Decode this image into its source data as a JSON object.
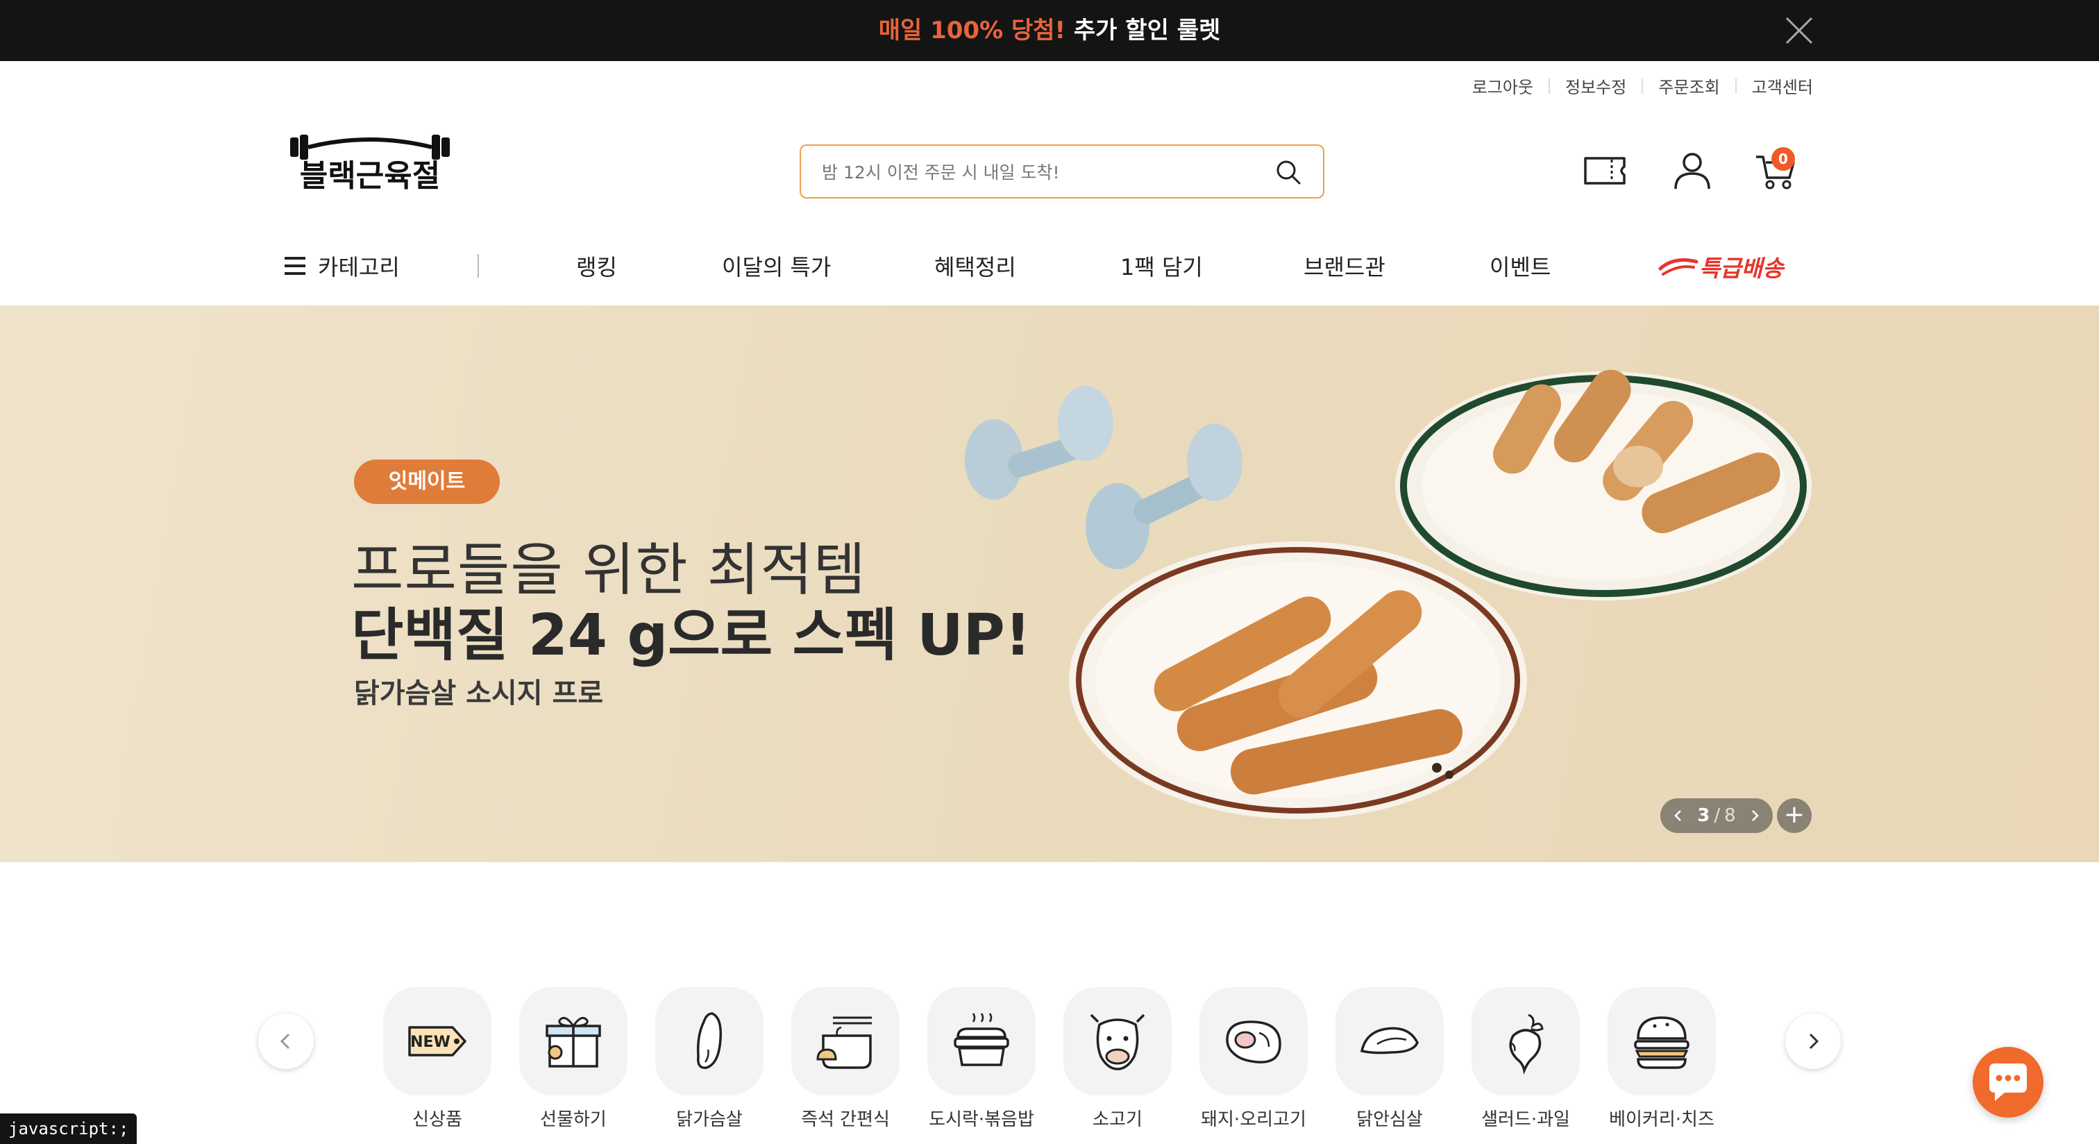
{
  "promo": {
    "text_prefix": "매일 100% 당첨!",
    "text_suffix": "추가 할인 룰렛"
  },
  "util_links": [
    "로그아웃",
    "정보수정",
    "주문조회",
    "고객센터"
  ],
  "logo_text": "블랙근육절",
  "search": {
    "placeholder": "밤 12시 이전 주문 시 내일 도착!"
  },
  "cart": {
    "count": "0"
  },
  "nav": {
    "category_label": "카테고리",
    "items": [
      "랭킹",
      "이달의 특가",
      "혜택정리",
      "1팩 담기",
      "브랜드관",
      "이벤트"
    ],
    "express_label": "특급배송"
  },
  "banner": {
    "tag": "잇메이트",
    "headline1": "프로들을 위한 최적템",
    "headline2": "단백질 24 g으로 스펙 UP!",
    "subtitle": "닭가슴살 소시지 프로",
    "pager": {
      "current": "3",
      "separator": "/",
      "total": "8"
    },
    "plus": "+"
  },
  "categories": [
    {
      "label": "신상품",
      "icon": "new-tag-icon"
    },
    {
      "label": "선물하기",
      "icon": "gift-icon"
    },
    {
      "label": "닭가슴살",
      "icon": "chicken-breast-icon"
    },
    {
      "label": "즉석 간편식",
      "icon": "instant-meal-icon"
    },
    {
      "label": "도시락·볶음밥",
      "icon": "lunchbox-icon"
    },
    {
      "label": "소고기",
      "icon": "cow-icon"
    },
    {
      "label": "돼지·오리고기",
      "icon": "meat-steak-icon"
    },
    {
      "label": "닭안심살",
      "icon": "tenderloin-icon"
    },
    {
      "label": "샐러드·과일",
      "icon": "radish-icon"
    },
    {
      "label": "베이커리·치즈",
      "icon": "burger-icon"
    }
  ],
  "new_badge_text": "NEW",
  "status_bar": "javascript:;",
  "colors": {
    "accent": "#f05a28",
    "promo_bg": "#141414",
    "banner_bg": "#ecdcbd",
    "search_border": "#f0a04a"
  }
}
